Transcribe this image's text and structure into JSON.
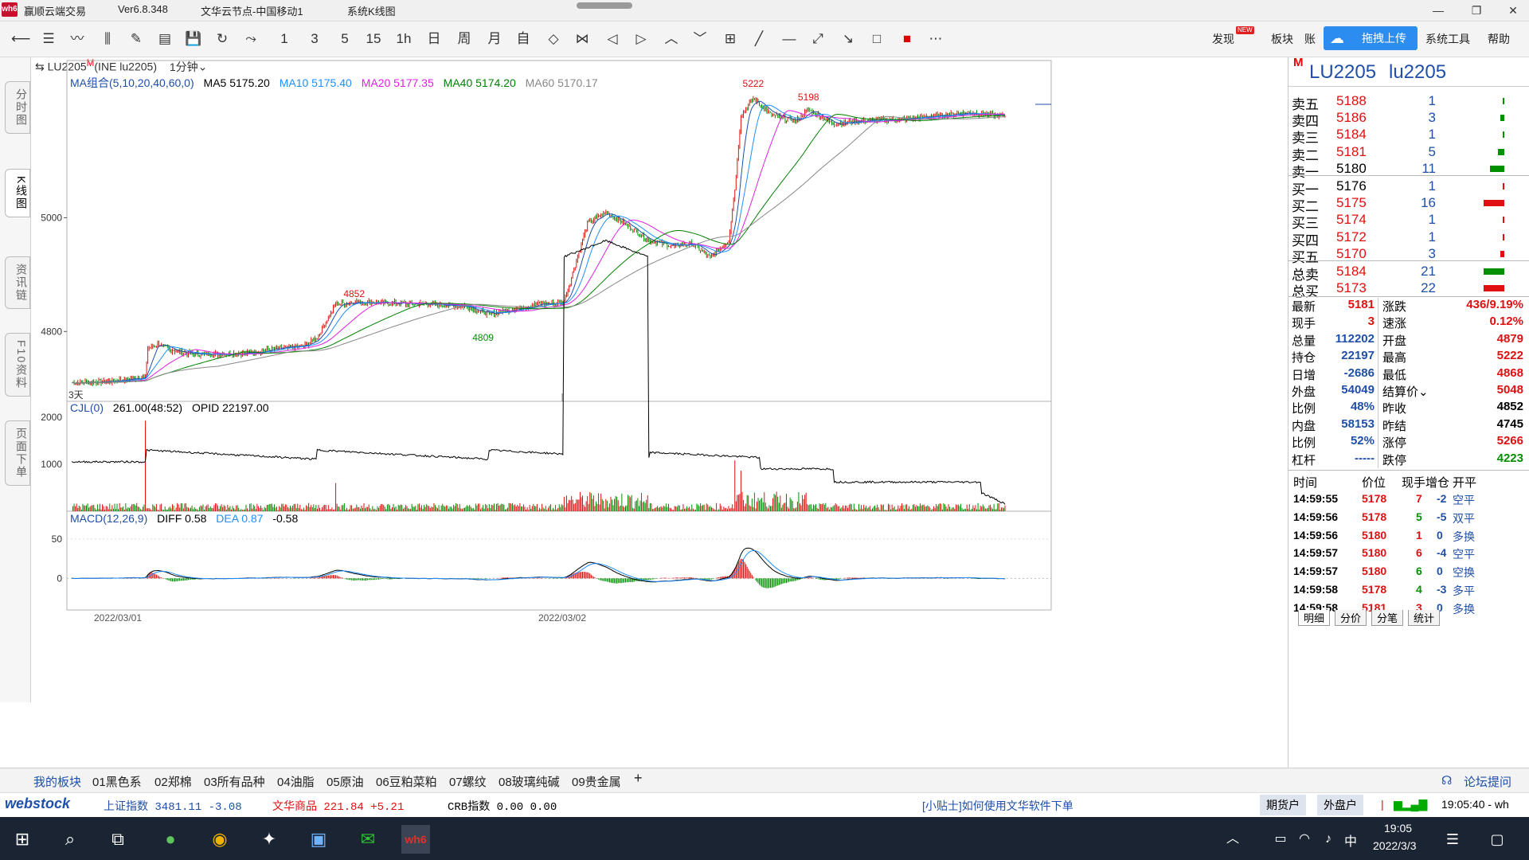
{
  "window": {
    "app_name": "赢顺云端交易",
    "version": "Ver6.8.348",
    "server": "文华云节点-中国移动1",
    "view": "系统K线图",
    "logo_text": "wh6"
  },
  "toolbar": {
    "periods": [
      "1",
      "3",
      "5",
      "15",
      "1h",
      "日",
      "周",
      "月",
      "自"
    ],
    "right_items": [
      "发现",
      "板块",
      "账"
    ],
    "new_badge": "NEW",
    "upload_label": "拖拽上传",
    "tools_label": "系统工具",
    "help_label": "帮助"
  },
  "left_tabs": [
    "分时图",
    "K线图",
    "资讯链",
    "F10资料",
    "页面下单"
  ],
  "symbol_header": {
    "symbol": "LU2205",
    "superscript": "M",
    "exchange_code": "(INE lu2205)",
    "period": "1分钟"
  },
  "ma_legend": {
    "group": "MA组合(5,10,20,40,60,0)",
    "ma5": "MA5 5175.20",
    "ma10": "MA10 5175.40",
    "ma20": "MA20 5177.35",
    "ma40": "MA40 5174.20",
    "ma60": "MA60 5170.17"
  },
  "vol_legend": {
    "name": "CJL(0)",
    "vol": "261.00(48:52)",
    "opid": "OPID 22197.00"
  },
  "macd_legend": {
    "name": "MACD(12,26,9)",
    "diff": "DIFF 0.58",
    "dea": "DEA 0.87",
    "macd": "-0.58"
  },
  "chart_annotations": {
    "high1": "5222",
    "high2": "5198",
    "mid_high": "4852",
    "mid_low": "4809",
    "corner": "3天"
  },
  "chart_data": {
    "type": "line",
    "price_axis_ticks": [
      5000,
      4800
    ],
    "vol_axis_ticks": [
      2000,
      1000
    ],
    "macd_axis_ticks": [
      50,
      0
    ],
    "x_labels": [
      "2022/03/01",
      "2022/03/02"
    ],
    "close_path": [
      [
        0,
        4710
      ],
      [
        30,
        4712
      ],
      [
        60,
        4720
      ],
      [
        62,
        4770
      ],
      [
        70,
        4778
      ],
      [
        80,
        4768
      ],
      [
        100,
        4760
      ],
      [
        140,
        4762
      ],
      [
        170,
        4770
      ],
      [
        190,
        4775
      ],
      [
        200,
        4790
      ],
      [
        215,
        4848
      ],
      [
        230,
        4852
      ],
      [
        260,
        4850
      ],
      [
        290,
        4848
      ],
      [
        320,
        4845
      ],
      [
        340,
        4830
      ],
      [
        360,
        4840
      ],
      [
        380,
        4848
      ],
      [
        400,
        4850
      ],
      [
        405,
        4880
      ],
      [
        420,
        4990
      ],
      [
        435,
        5010
      ],
      [
        450,
        4990
      ],
      [
        470,
        4960
      ],
      [
        490,
        4950
      ],
      [
        505,
        4955
      ],
      [
        520,
        4930
      ],
      [
        535,
        4960
      ],
      [
        540,
        5050
      ],
      [
        545,
        5180
      ],
      [
        555,
        5210
      ],
      [
        570,
        5180
      ],
      [
        590,
        5170
      ],
      [
        600,
        5190
      ],
      [
        620,
        5165
      ],
      [
        640,
        5170
      ],
      [
        670,
        5172
      ],
      [
        700,
        5178
      ],
      [
        730,
        5185
      ],
      [
        760,
        5178
      ]
    ],
    "volume_note": "per-minute volume bars with 0–2000 scale",
    "macd_axis_range": [
      -40,
      75
    ]
  },
  "order_book": {
    "title_code": "LU2205",
    "title_name": "lu2205",
    "badge": "M",
    "asks": [
      {
        "label": "卖五",
        "price": "5188",
        "qty": "1",
        "bar": 0.06
      },
      {
        "label": "卖四",
        "price": "5186",
        "qty": "3",
        "bar": 0.19
      },
      {
        "label": "卖三",
        "price": "5184",
        "qty": "1",
        "bar": 0.06
      },
      {
        "label": "卖二",
        "price": "5181",
        "qty": "5",
        "bar": 0.31
      },
      {
        "label": "卖一",
        "price": "5180",
        "qty": "11",
        "bar": 0.69
      }
    ],
    "bids": [
      {
        "label": "买一",
        "price": "5176",
        "qty": "1",
        "bar": 0.06
      },
      {
        "label": "买二",
        "price": "5175",
        "qty": "16",
        "bar": 1.0
      },
      {
        "label": "买三",
        "price": "5174",
        "qty": "1",
        "bar": 0.06
      },
      {
        "label": "买四",
        "price": "5172",
        "qty": "1",
        "bar": 0.06
      },
      {
        "label": "买五",
        "price": "5170",
        "qty": "3",
        "bar": 0.19
      }
    ],
    "totals": [
      {
        "label": "总卖",
        "price": "5184",
        "qty": "21",
        "color": "green"
      },
      {
        "label": "总买",
        "price": "5173",
        "qty": "22",
        "color": "red"
      }
    ]
  },
  "quote_stats": {
    "left": [
      {
        "label": "最新",
        "value": "5181",
        "cls": "red"
      },
      {
        "label": "现手",
        "value": "3",
        "cls": "red"
      },
      {
        "label": "总量",
        "value": "112202",
        "cls": "blue"
      },
      {
        "label": "持仓",
        "value": "22197",
        "cls": "blue"
      },
      {
        "label": "日增",
        "value": "-2686",
        "cls": "blue"
      },
      {
        "label": "外盘",
        "value": "54049",
        "cls": "blue"
      },
      {
        "label": "比例",
        "value": "48%",
        "cls": "blue"
      },
      {
        "label": "内盘",
        "value": "58153",
        "cls": "blue"
      },
      {
        "label": "比例",
        "value": "52%",
        "cls": "blue"
      },
      {
        "label": "杠杆",
        "value": "-----",
        "cls": "blue"
      }
    ],
    "right": [
      {
        "label": "涨跌",
        "value": "436/9.19%",
        "cls": "red"
      },
      {
        "label": "速涨",
        "value": "0.12%",
        "cls": "red"
      },
      {
        "label": "开盘",
        "value": "4879",
        "cls": "red"
      },
      {
        "label": "最高",
        "value": "5222",
        "cls": "red"
      },
      {
        "label": "最低",
        "value": "4868",
        "cls": "red"
      },
      {
        "label": "结算价",
        "value": "5048",
        "cls": "red"
      },
      {
        "label": "昨收",
        "value": "4852",
        "cls": "dark"
      },
      {
        "label": "昨结",
        "value": "4745",
        "cls": "dark"
      },
      {
        "label": "涨停",
        "value": "5266",
        "cls": "red"
      },
      {
        "label": "跌停",
        "value": "4223",
        "cls": "green"
      }
    ]
  },
  "ticks": {
    "headers": [
      "时间",
      "价位",
      "现手",
      "增仓",
      "开平"
    ],
    "rows": [
      {
        "time": "14:59:55",
        "price": "5178",
        "qty": "7",
        "chg": "-2",
        "type": "空平",
        "qc": "red"
      },
      {
        "time": "14:59:56",
        "price": "5178",
        "qty": "5",
        "chg": "-5",
        "type": "双平",
        "qc": "green"
      },
      {
        "time": "14:59:56",
        "price": "5180",
        "qty": "1",
        "chg": "0",
        "type": "多换",
        "qc": "red"
      },
      {
        "time": "14:59:57",
        "price": "5180",
        "qty": "6",
        "chg": "-4",
        "type": "空平",
        "qc": "red"
      },
      {
        "time": "14:59:57",
        "price": "5180",
        "qty": "6",
        "chg": "0",
        "type": "空换",
        "qc": "green"
      },
      {
        "time": "14:59:58",
        "price": "5178",
        "qty": "4",
        "chg": "-3",
        "type": "多平",
        "qc": "green"
      },
      {
        "time": "14:59:58",
        "price": "5181",
        "qty": "3",
        "chg": "0",
        "type": "多换",
        "qc": "red"
      }
    ],
    "tabs": [
      "明细",
      "分价",
      "分笔",
      "统计"
    ]
  },
  "boards": {
    "items": [
      "我的板块",
      "01黑色系",
      "02郑棉",
      "03所有品种",
      "04油脂",
      "05原油",
      "06豆粕菜粕",
      "07螺纹",
      "08玻璃纯碱",
      "09贵金属"
    ],
    "add": "+",
    "forum": "论坛提问"
  },
  "statusbar": {
    "brand": "webstock",
    "idx1": "上证指数  3481.11  -3.08",
    "idx2": "文华商品  221.84  +5.21",
    "idx3": "CRB指数   0.00  0.00",
    "tip": "[小贴士]如何使用文华软件下单",
    "btn1": "期货户",
    "btn2": "外盘户",
    "time": "19:05:40 - wh"
  },
  "taskbar": {
    "time": "19:05",
    "date": "2022/3/3",
    "ime": "中"
  },
  "colors": {
    "ma5": "#1f4fa8",
    "ma10": "#1f8fff",
    "ma20": "#e020e0",
    "ma40": "#008000",
    "ma60": "#888888",
    "up": "#e01010",
    "down": "#009000",
    "upload": "#2d8cf0"
  }
}
